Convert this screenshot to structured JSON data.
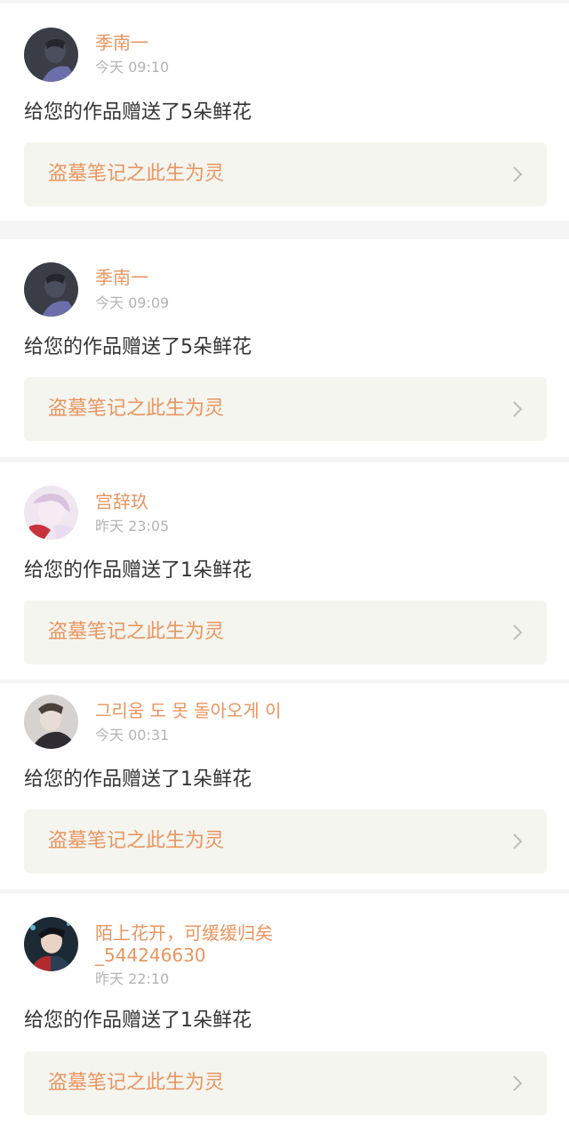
{
  "notifications": [
    {
      "username": "季南一",
      "time": "今天 09:10",
      "message": "给您的作品赠送了5朵鲜花",
      "work_title": "盗墓笔记之此生为灵",
      "avatar_icon": "user-avatar-icon"
    },
    {
      "username": "季南一",
      "time": "今天 09:09",
      "message": "给您的作品赠送了5朵鲜花",
      "work_title": "盗墓笔记之此生为灵",
      "avatar_icon": "user-avatar-icon"
    },
    {
      "username": "宫辞玖",
      "time": "昨天 23:05",
      "message": "给您的作品赠送了1朵鲜花",
      "work_title": "盗墓笔记之此生为灵",
      "avatar_icon": "user-avatar-icon"
    },
    {
      "username": "그리움 도 못 돌아오게 이",
      "time": "今天 00:31",
      "message": "给您的作品赠送了1朵鲜花",
      "work_title": "盗墓笔记之此生为灵",
      "avatar_icon": "user-avatar-icon"
    },
    {
      "username_line1": "陌上花开，可缓缓归矣",
      "username_line2": "_544246630",
      "time": "昨天 22:10",
      "message": "给您的作品赠送了1朵鲜花",
      "work_title": "盗墓笔记之此生为灵",
      "avatar_icon": "user-avatar-icon"
    }
  ],
  "colors": {
    "accent": "#e8955f",
    "muted": "#b4b4b4",
    "text": "#333333",
    "link_background": "#f5f5f0",
    "page_background": "#f5f5f5"
  },
  "icons": {
    "chevron": "chevron-right-icon"
  }
}
